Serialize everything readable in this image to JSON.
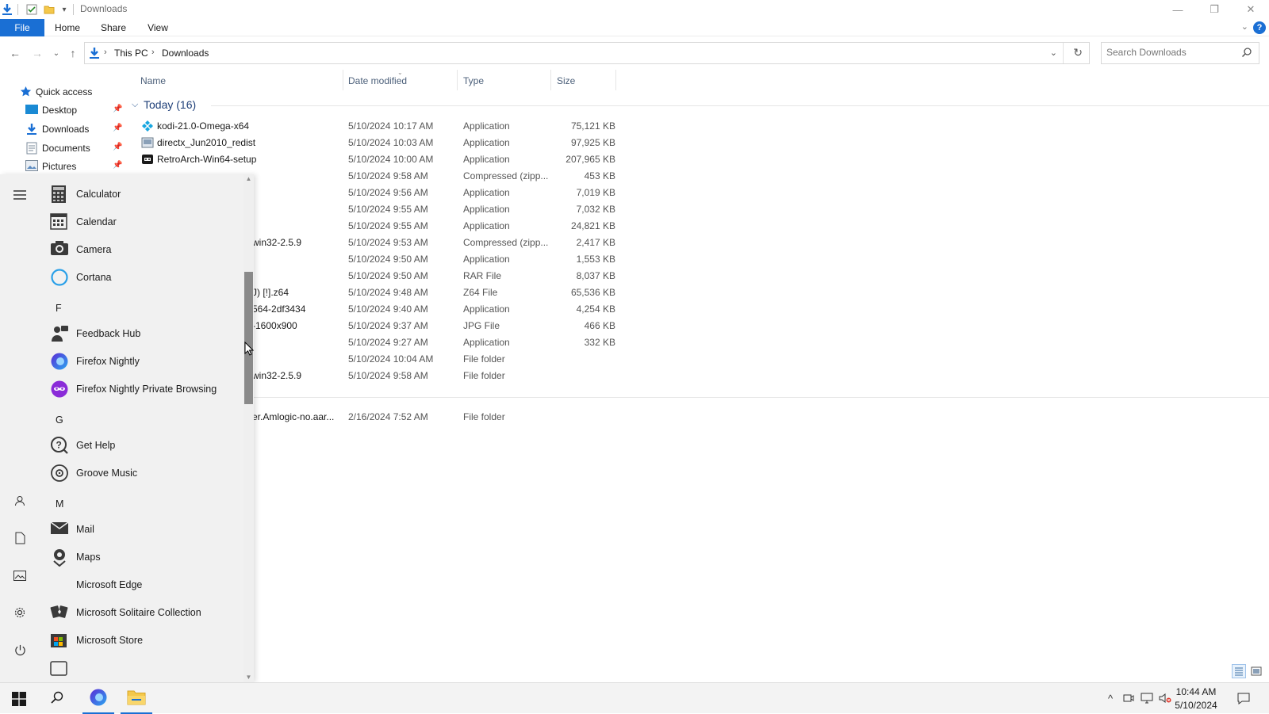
{
  "window": {
    "title": "Downloads"
  },
  "ribbon": {
    "tabs": [
      {
        "label": "File"
      },
      {
        "label": "Home"
      },
      {
        "label": "Share"
      },
      {
        "label": "View"
      }
    ],
    "help_label": "?"
  },
  "address": {
    "crumbs": [
      "This PC",
      "Downloads"
    ]
  },
  "search": {
    "placeholder": "Search Downloads"
  },
  "navpane": {
    "items": [
      {
        "label": "Quick access",
        "icon": "star-icon"
      },
      {
        "label": "Desktop",
        "icon": "desktop-folder-icon"
      },
      {
        "label": "Downloads",
        "icon": "download-arrow-icon"
      },
      {
        "label": "Documents",
        "icon": "documents-icon"
      },
      {
        "label": "Pictures",
        "icon": "pictures-icon"
      }
    ]
  },
  "columns": [
    "Name",
    "Date modified",
    "Type",
    "Size"
  ],
  "groups": {
    "today": "Today (16)"
  },
  "files": [
    {
      "name": "kodi-21.0-Omega-x64",
      "date": "5/10/2024 10:17 AM",
      "type": "Application",
      "size": "75,121 KB",
      "icon": "kodi-icon"
    },
    {
      "name": "directx_Jun2010_redist",
      "date": "5/10/2024 10:03 AM",
      "type": "Application",
      "size": "97,925 KB",
      "icon": "installer-icon"
    },
    {
      "name": "RetroArch-Win64-setup",
      "date": "5/10/2024 10:00 AM",
      "type": "Application",
      "size": "207,965 KB",
      "icon": "retroarch-icon"
    },
    {
      "name": "",
      "date": "5/10/2024 9:58 AM",
      "type": "Compressed (zipp...",
      "size": "453 KB",
      "icon": "zip-folder-icon"
    },
    {
      "name": "",
      "date": "5/10/2024 9:56 AM",
      "type": "Application",
      "size": "7,019 KB",
      "icon": ""
    },
    {
      "name": "",
      "date": "5/10/2024 9:55 AM",
      "type": "Application",
      "size": "7,032 KB",
      "icon": ""
    },
    {
      "name": "",
      "date": "5/10/2024 9:55 AM",
      "type": "Application",
      "size": "24,821 KB",
      "icon": ""
    },
    {
      "name": "win32-2.5.9",
      "date": "5/10/2024 9:53 AM",
      "type": "Compressed (zipp...",
      "size": "2,417 KB",
      "icon": ""
    },
    {
      "name": "",
      "date": "5/10/2024 9:50 AM",
      "type": "Application",
      "size": "1,553 KB",
      "icon": ""
    },
    {
      "name": "",
      "date": "5/10/2024 9:50 AM",
      "type": "RAR File",
      "size": "8,037 KB",
      "icon": ""
    },
    {
      "name": "J) [!].z64",
      "date": "5/10/2024 9:48 AM",
      "type": "Z64 File",
      "size": "65,536 KB",
      "icon": ""
    },
    {
      "name": "564-2df3434",
      "date": "5/10/2024 9:40 AM",
      "type": "Application",
      "size": "4,254 KB",
      "icon": ""
    },
    {
      "name": "-1600x900",
      "date": "5/10/2024 9:37 AM",
      "type": "JPG File",
      "size": "466 KB",
      "icon": ""
    },
    {
      "name": "",
      "date": "5/10/2024 9:27 AM",
      "type": "Application",
      "size": "332 KB",
      "icon": ""
    },
    {
      "name": "",
      "date": "5/10/2024 10:04 AM",
      "type": "File folder",
      "size": "",
      "icon": ""
    },
    {
      "name": "win32-2.5.9",
      "date": "5/10/2024 9:58 AM",
      "type": "File folder",
      "size": "",
      "icon": ""
    }
  ],
  "earlier_files": [
    {
      "name": "er.Amlogic-no.aar...",
      "date": "2/16/2024 7:52 AM",
      "type": "File folder",
      "size": ""
    }
  ],
  "startmenu": {
    "apps": [
      {
        "label": "Calculator",
        "icon": "calculator-icon"
      },
      {
        "label": "Calendar",
        "icon": "calendar-icon"
      },
      {
        "label": "Camera",
        "icon": "camera-icon"
      },
      {
        "label": "Cortana",
        "icon": "cortana-icon"
      },
      {
        "label": "Feedback Hub",
        "icon": "feedback-hub-icon"
      },
      {
        "label": "Firefox Nightly",
        "icon": "firefox-nightly-icon"
      },
      {
        "label": "Firefox Nightly Private Browsing",
        "icon": "firefox-private-icon"
      },
      {
        "label": "Get Help",
        "icon": "get-help-icon"
      },
      {
        "label": "Groove Music",
        "icon": "groove-music-icon"
      },
      {
        "label": "Mail",
        "icon": "mail-icon"
      },
      {
        "label": "Maps",
        "icon": "maps-icon"
      },
      {
        "label": "Microsoft Edge",
        "icon": ""
      },
      {
        "label": "Microsoft Solitaire Collection",
        "icon": "solitaire-icon"
      },
      {
        "label": "Microsoft Store",
        "icon": "store-icon"
      }
    ],
    "letters": [
      "F",
      "G",
      "M"
    ]
  },
  "clock": {
    "time": "10:44 AM",
    "date": "5/10/2024"
  }
}
